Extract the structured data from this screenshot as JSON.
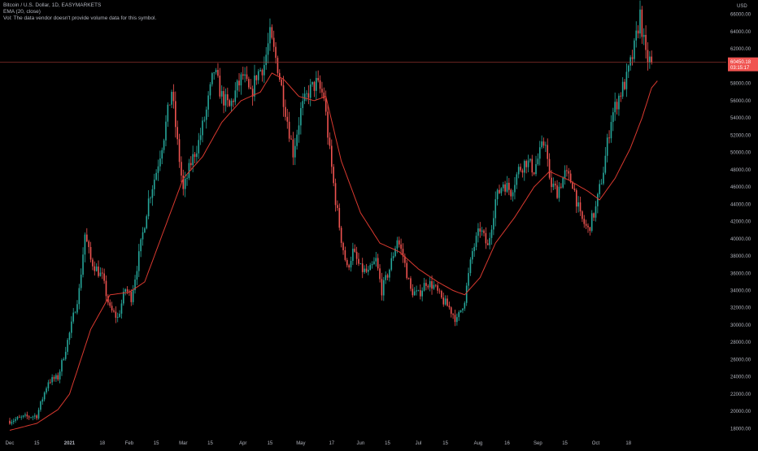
{
  "legend": {
    "symbol": "Bitcoin / U.S. Dollar, 1D, EASYMARKETS",
    "ema": "EMA (20, close)",
    "vol": "Vol: The data vendor doesn't provide volume data for this symbol."
  },
  "price_axis": {
    "currency": "USD",
    "last_price_label": "60450.18",
    "countdown_label": "03:15:17"
  },
  "colors": {
    "background": "#000000",
    "up": "#26a69a",
    "down": "#ef5350",
    "ema": "#d9392f",
    "text": "#b2b5be",
    "price_line": "#a23a33",
    "price_tag": "#f05350"
  },
  "chart_data": {
    "type": "candlestick",
    "interval": "1D",
    "ylim": [
      17000,
      67200
    ],
    "y_ticks": [
      18000,
      20000,
      22000,
      24000,
      26000,
      28000,
      30000,
      32000,
      34000,
      36000,
      38000,
      40000,
      42000,
      44000,
      46000,
      48000,
      50000,
      52000,
      54000,
      56000,
      58000,
      60000,
      62000,
      64000,
      66000
    ],
    "y_tick_labels": [
      "18000.00",
      "20000.00",
      "22000.00",
      "24000.00",
      "26000.00",
      "28000.00",
      "30000.00",
      "32000.00",
      "34000.00",
      "36000.00",
      "38000.00",
      "40000.00",
      "42000.00",
      "44000.00",
      "46000.00",
      "48000.00",
      "50000.00",
      "52000.00",
      "54000.00",
      "56000.00",
      "58000.00",
      "60000.00",
      "62000.00",
      "64000.00",
      "66000.00"
    ],
    "x_ticks": [
      {
        "label": "Dec",
        "day": 0,
        "bold": false
      },
      {
        "label": "15",
        "day": 14,
        "bold": false
      },
      {
        "label": "2021",
        "day": 31,
        "bold": true
      },
      {
        "label": "18",
        "day": 48,
        "bold": false
      },
      {
        "label": "Feb",
        "day": 62,
        "bold": false
      },
      {
        "label": "15",
        "day": 76,
        "bold": false
      },
      {
        "label": "Mar",
        "day": 90,
        "bold": false
      },
      {
        "label": "15",
        "day": 104,
        "bold": false
      },
      {
        "label": "Apr",
        "day": 121,
        "bold": false
      },
      {
        "label": "15",
        "day": 135,
        "bold": false
      },
      {
        "label": "May",
        "day": 151,
        "bold": false
      },
      {
        "label": "17",
        "day": 167,
        "bold": false
      },
      {
        "label": "Jun",
        "day": 182,
        "bold": false
      },
      {
        "label": "15",
        "day": 196,
        "bold": false
      },
      {
        "label": "Jul",
        "day": 212,
        "bold": false
      },
      {
        "label": "15",
        "day": 226,
        "bold": false
      },
      {
        "label": "Aug",
        "day": 243,
        "bold": false
      },
      {
        "label": "16",
        "day": 258,
        "bold": false
      },
      {
        "label": "Sep",
        "day": 274,
        "bold": false
      },
      {
        "label": "15",
        "day": 288,
        "bold": false
      },
      {
        "label": "Oct",
        "day": 304,
        "bold": false
      },
      {
        "label": "18",
        "day": 321,
        "bold": false
      }
    ],
    "series": [
      {
        "name": "Bitcoin / U.S. Dollar",
        "kind": "close",
        "values": [
          {
            "day": 0,
            "value": 18900
          },
          {
            "day": 7,
            "value": 19300
          },
          {
            "day": 14,
            "value": 19500
          },
          {
            "day": 20,
            "value": 23500
          },
          {
            "day": 25,
            "value": 23900
          },
          {
            "day": 31,
            "value": 29000
          },
          {
            "day": 36,
            "value": 34000
          },
          {
            "day": 39,
            "value": 40500
          },
          {
            "day": 42,
            "value": 37500
          },
          {
            "day": 48,
            "value": 35500
          },
          {
            "day": 52,
            "value": 31800
          },
          {
            "day": 56,
            "value": 30800
          },
          {
            "day": 60,
            "value": 34200
          },
          {
            "day": 63,
            "value": 33200
          },
          {
            "day": 67,
            "value": 38000
          },
          {
            "day": 72,
            "value": 44500
          },
          {
            "day": 76,
            "value": 47800
          },
          {
            "day": 80,
            "value": 52000
          },
          {
            "day": 84,
            "value": 57200
          },
          {
            "day": 87,
            "value": 51000
          },
          {
            "day": 90,
            "value": 45500
          },
          {
            "day": 94,
            "value": 48800
          },
          {
            "day": 98,
            "value": 51200
          },
          {
            "day": 102,
            "value": 54800
          },
          {
            "day": 106,
            "value": 59500
          },
          {
            "day": 110,
            "value": 56500
          },
          {
            "day": 114,
            "value": 55200
          },
          {
            "day": 118,
            "value": 57500
          },
          {
            "day": 121,
            "value": 58900
          },
          {
            "day": 125,
            "value": 56500
          },
          {
            "day": 128,
            "value": 59000
          },
          {
            "day": 132,
            "value": 60200
          },
          {
            "day": 135,
            "value": 63500
          },
          {
            "day": 139,
            "value": 60000
          },
          {
            "day": 143,
            "value": 55000
          },
          {
            "day": 147,
            "value": 50000
          },
          {
            "day": 151,
            "value": 54800
          },
          {
            "day": 155,
            "value": 57000
          },
          {
            "day": 159,
            "value": 58000
          },
          {
            "day": 163,
            "value": 56500
          },
          {
            "day": 166,
            "value": 50000
          },
          {
            "day": 169,
            "value": 44500
          },
          {
            "day": 172,
            "value": 40000
          },
          {
            "day": 175,
            "value": 36500
          },
          {
            "day": 178,
            "value": 38500
          },
          {
            "day": 182,
            "value": 36500
          },
          {
            "day": 186,
            "value": 36000
          },
          {
            "day": 190,
            "value": 37500
          },
          {
            "day": 193,
            "value": 34000
          },
          {
            "day": 197,
            "value": 36500
          },
          {
            "day": 201,
            "value": 40000
          },
          {
            "day": 204,
            "value": 38000
          },
          {
            "day": 208,
            "value": 34000
          },
          {
            "day": 212,
            "value": 33500
          },
          {
            "day": 216,
            "value": 35000
          },
          {
            "day": 220,
            "value": 34500
          },
          {
            "day": 224,
            "value": 33000
          },
          {
            "day": 228,
            "value": 32000
          },
          {
            "day": 232,
            "value": 30500
          },
          {
            "day": 236,
            "value": 33000
          },
          {
            "day": 240,
            "value": 38500
          },
          {
            "day": 244,
            "value": 41200
          },
          {
            "day": 248,
            "value": 39000
          },
          {
            "day": 252,
            "value": 44500
          },
          {
            "day": 256,
            "value": 46500
          },
          {
            "day": 260,
            "value": 45500
          },
          {
            "day": 264,
            "value": 48000
          },
          {
            "day": 268,
            "value": 49000
          },
          {
            "day": 272,
            "value": 48000
          },
          {
            "day": 276,
            "value": 50500
          },
          {
            "day": 278,
            "value": 51500
          },
          {
            "day": 280,
            "value": 46500
          },
          {
            "day": 284,
            "value": 45500
          },
          {
            "day": 288,
            "value": 47500
          },
          {
            "day": 292,
            "value": 46500
          },
          {
            "day": 296,
            "value": 42500
          },
          {
            "day": 300,
            "value": 41000
          },
          {
            "day": 304,
            "value": 43500
          },
          {
            "day": 308,
            "value": 48000
          },
          {
            "day": 312,
            "value": 54000
          },
          {
            "day": 316,
            "value": 56500
          },
          {
            "day": 320,
            "value": 58500
          },
          {
            "day": 324,
            "value": 62000
          },
          {
            "day": 327,
            "value": 66000
          },
          {
            "day": 330,
            "value": 61000
          },
          {
            "day": 333,
            "value": 60450
          }
        ]
      },
      {
        "name": "EMA (20, close)",
        "kind": "ema",
        "values": [
          {
            "day": 0,
            "value": 17800
          },
          {
            "day": 14,
            "value": 18600
          },
          {
            "day": 25,
            "value": 20200
          },
          {
            "day": 31,
            "value": 22000
          },
          {
            "day": 42,
            "value": 29500
          },
          {
            "day": 52,
            "value": 33500
          },
          {
            "day": 62,
            "value": 33800
          },
          {
            "day": 70,
            "value": 35000
          },
          {
            "day": 80,
            "value": 41000
          },
          {
            "day": 90,
            "value": 47000
          },
          {
            "day": 100,
            "value": 49500
          },
          {
            "day": 110,
            "value": 53500
          },
          {
            "day": 120,
            "value": 56000
          },
          {
            "day": 130,
            "value": 57000
          },
          {
            "day": 136,
            "value": 59200
          },
          {
            "day": 142,
            "value": 58500
          },
          {
            "day": 150,
            "value": 56500
          },
          {
            "day": 158,
            "value": 56000
          },
          {
            "day": 164,
            "value": 56500
          },
          {
            "day": 172,
            "value": 49000
          },
          {
            "day": 182,
            "value": 43000
          },
          {
            "day": 192,
            "value": 39500
          },
          {
            "day": 202,
            "value": 38500
          },
          {
            "day": 212,
            "value": 36500
          },
          {
            "day": 222,
            "value": 35000
          },
          {
            "day": 230,
            "value": 34000
          },
          {
            "day": 236,
            "value": 33500
          },
          {
            "day": 244,
            "value": 35500
          },
          {
            "day": 252,
            "value": 39500
          },
          {
            "day": 262,
            "value": 42500
          },
          {
            "day": 272,
            "value": 46000
          },
          {
            "day": 280,
            "value": 47800
          },
          {
            "day": 290,
            "value": 46800
          },
          {
            "day": 300,
            "value": 45500
          },
          {
            "day": 306,
            "value": 44500
          },
          {
            "day": 314,
            "value": 47000
          },
          {
            "day": 322,
            "value": 50500
          },
          {
            "day": 328,
            "value": 54000
          },
          {
            "day": 333,
            "value": 57500
          },
          {
            "day": 336,
            "value": 58300
          }
        ]
      }
    ]
  }
}
